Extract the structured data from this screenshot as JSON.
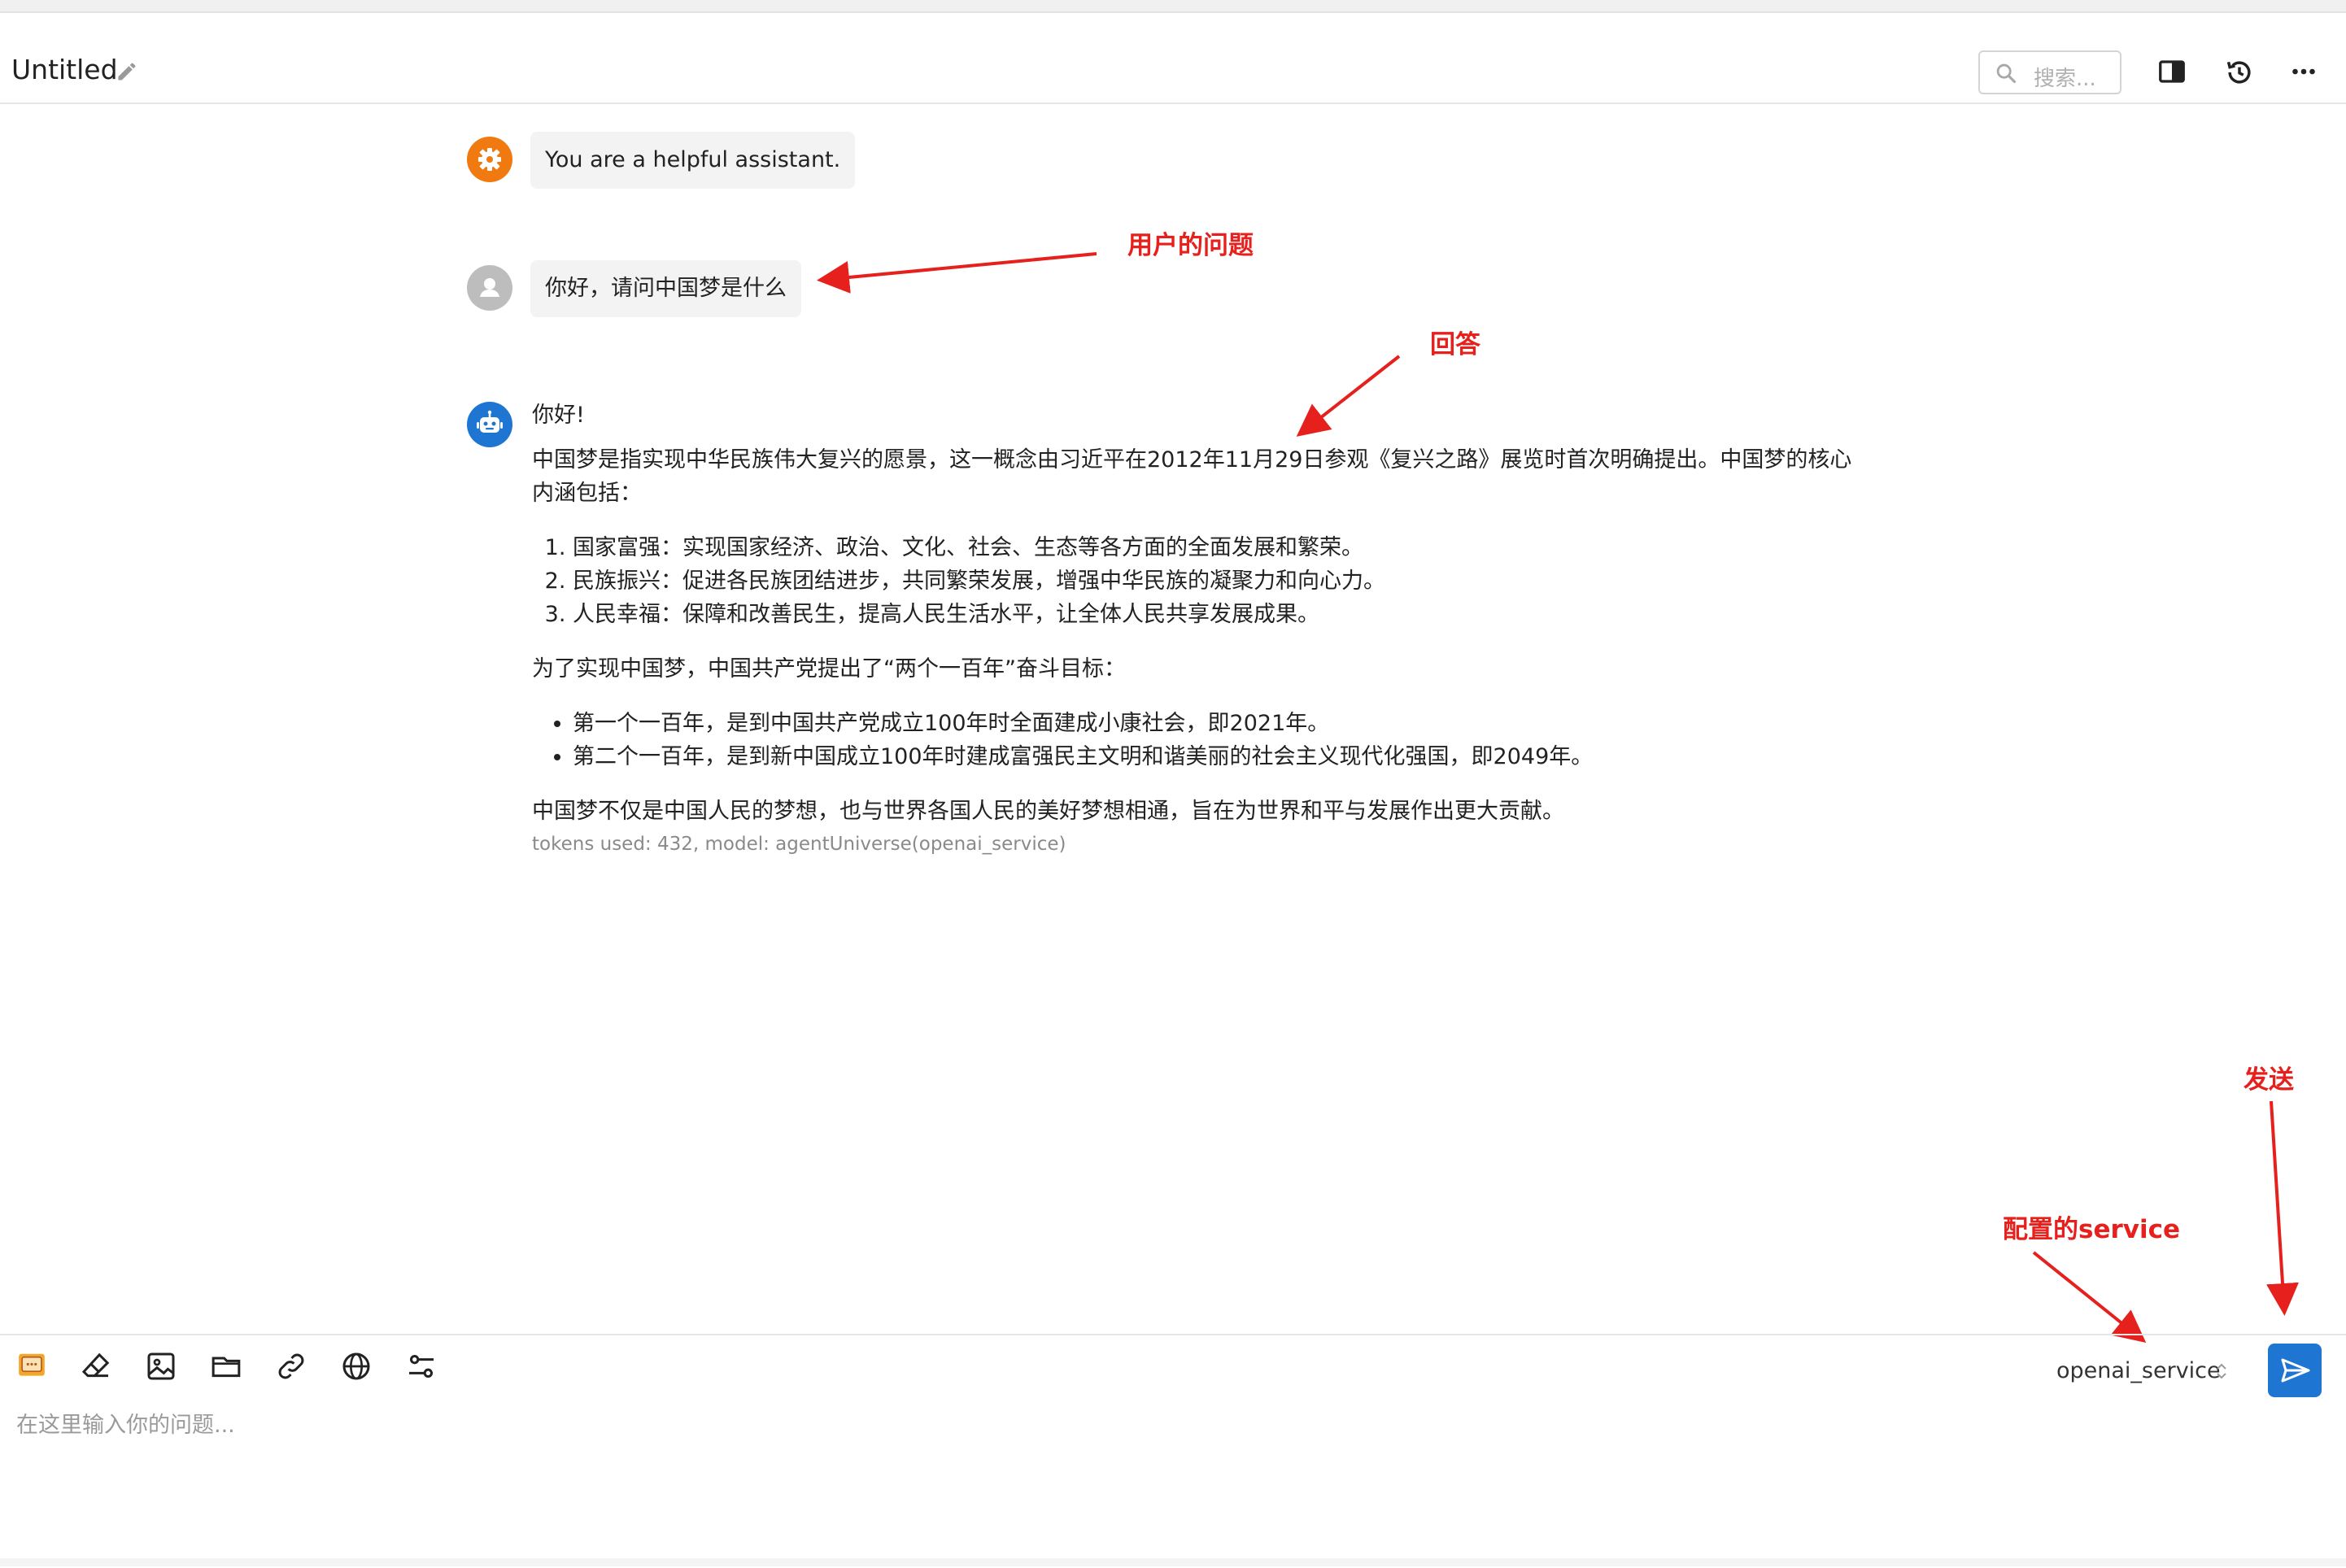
{
  "header": {
    "title": "Untitled",
    "search_placeholder": "搜索..."
  },
  "messages": {
    "system": "You are a helpful assistant.",
    "user": "你好，请问中国梦是什么",
    "answer": {
      "greeting": "你好!",
      "intro": "中国梦是指实现中华民族伟大复兴的愿景，这一概念由习近平在2012年11月29日参观《复兴之路》展览时首次明确提出。中国梦的核心内涵包括：",
      "points": [
        "国家富强：实现国家经济、政治、文化、社会、生态等各方面的全面发展和繁荣。",
        "民族振兴：促进各民族团结进步，共同繁荣发展，增强中华民族的凝聚力和向心力。",
        "人民幸福：保障和改善民生，提高人民生活水平，让全体人民共享发展成果。"
      ],
      "goals_intro": "为了实现中国梦，中国共产党提出了“两个一百年”奋斗目标：",
      "goals": [
        "第一个一百年，是到中国共产党成立100年时全面建成小康社会，即2021年。",
        "第二个一百年，是到新中国成立100年时建成富强民主文明和谐美丽的社会主义现代化强国，即2049年。"
      ],
      "conclusion": "中国梦不仅是中国人民的梦想，也与世界各国人民的美好梦想相通，旨在为世界和平与发展作出更大贡献。",
      "tokens": "tokens used: 432, model: agentUniverse(openai_service)"
    }
  },
  "annotations": {
    "user_question": "用户的问题",
    "answer": "回答",
    "send": "发送",
    "service": "配置的service"
  },
  "input": {
    "placeholder": "在这里输入你的问题...",
    "service": "openai_service"
  },
  "colors": {
    "accent": "#1f76d2",
    "system_avatar": "#f07a10",
    "user_avatar": "#bdbdbd",
    "bot_avatar": "#1f76d2",
    "annotation": "#e6201c"
  },
  "icons": [
    "pencil-icon",
    "search-icon",
    "split-view-icon",
    "history-icon",
    "more-icon",
    "gear-icon",
    "user-icon",
    "robot-icon",
    "chat-icon",
    "eraser-icon",
    "image-icon",
    "folder-icon",
    "link-icon",
    "globe-icon",
    "settings-sliders-icon",
    "sort-icon",
    "send-icon"
  ]
}
